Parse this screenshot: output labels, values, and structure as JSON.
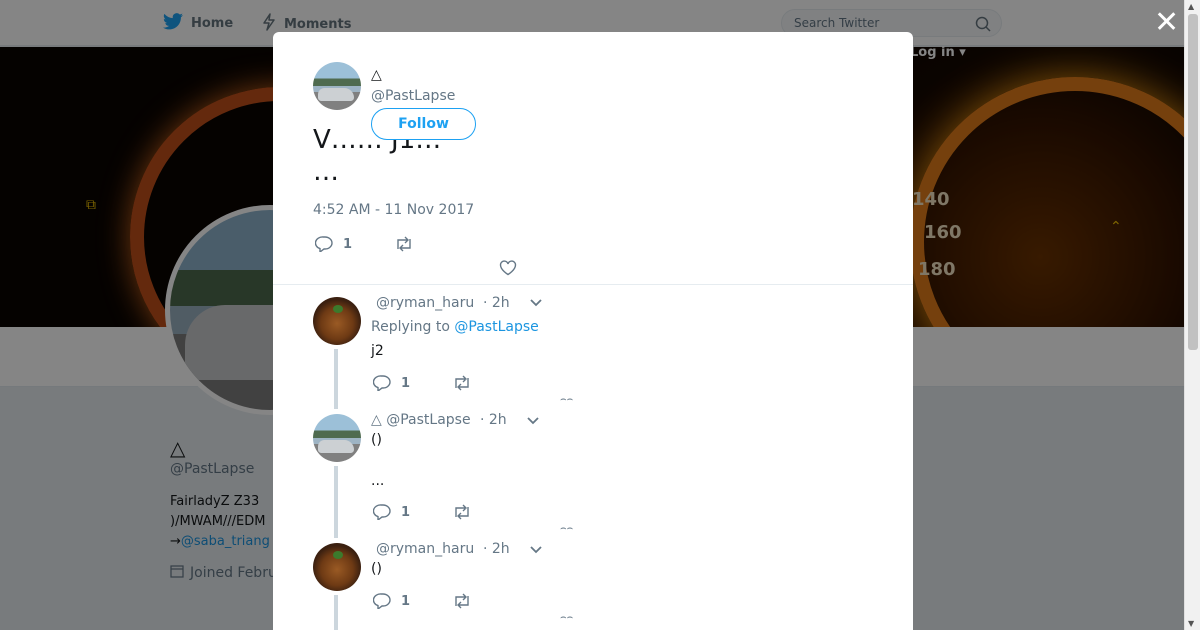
{
  "nav": {
    "home": "Home",
    "moments": "Moments",
    "search_placeholder": "Search Twitter",
    "login": "Log in"
  },
  "banner": {
    "speeds": [
      "140",
      "160",
      "180"
    ]
  },
  "profile": {
    "name": "△",
    "handle": "@PastLapse",
    "bio_line1": "FairladyZ Z33",
    "bio_line2": ")/MWAM///EDM",
    "bio_arrow": "→",
    "bio_link": "@saba_triang",
    "joined": "Joined Febru"
  },
  "modal": {
    "author_name": "△",
    "author_handle": "@PastLapse",
    "follow_label": "Follow",
    "tweet_line1": "V…… J1…",
    "tweet_line2": "…",
    "timestamp": "4:52 AM - 11 Nov 2017",
    "reply_count": "1",
    "divider_dots": "⌢⌢"
  },
  "replies": [
    {
      "name": "",
      "handle": "@ryman_haru",
      "time": "· 2h",
      "replying_to_label": "Replying to",
      "replying_to": "@PastLapse",
      "text": "j2",
      "text2": "",
      "reply_count": "1",
      "avatar": "food-avatar"
    },
    {
      "name": "△",
      "handle": "@PastLapse",
      "time": "· 2h",
      "replying_to_label": "",
      "replying_to": "",
      "text": "()",
      "text2": "...",
      "reply_count": "1",
      "avatar": "car-avatar"
    },
    {
      "name": "",
      "handle": "@ryman_haru",
      "time": "· 2h",
      "replying_to_label": "",
      "replying_to": "",
      "text": "()",
      "text2": "",
      "reply_count": "1",
      "avatar": "food-avatar"
    }
  ],
  "colors": {
    "accent": "#1da1f2",
    "link": "#1b95e0",
    "muted": "#657786",
    "overlay": "rgba(0,0,0,0.48)"
  }
}
